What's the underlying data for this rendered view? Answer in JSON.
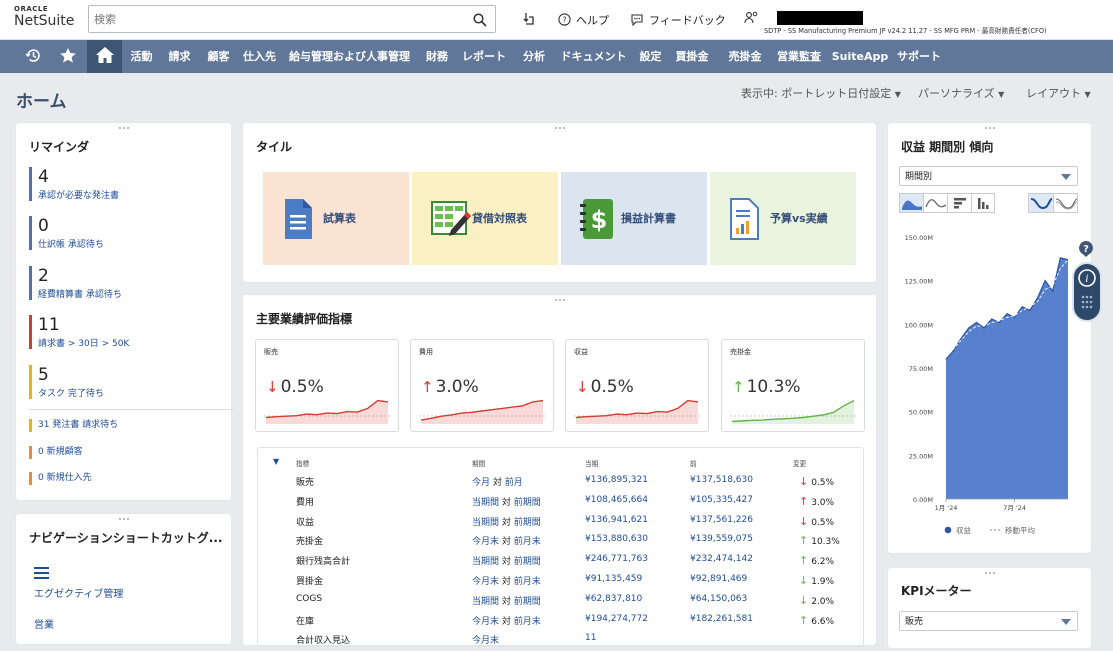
{
  "brand": {
    "oracle": "ORACLE",
    "netsuite": "NetSuite"
  },
  "topbar": {
    "search_placeholder": "検索",
    "help": "ヘルプ",
    "feedback": "フィードバック",
    "role": "SDTP - SS Manufacturing Premium JP v24.2 11.27 - SS MFG PRM - 最高財務責任者(CFO)"
  },
  "nav": {
    "items": [
      "活動",
      "請求",
      "顧客",
      "仕入先",
      "給与管理および人事管理",
      "財務",
      "レポート",
      "分析",
      "ドキュメント",
      "設定",
      "買掛金",
      "売掛金",
      "営業監査",
      "SuiteApp",
      "サポート"
    ]
  },
  "page": {
    "title": "ホーム",
    "view_label": "表示中: ポートレット日付設定",
    "personalize": "パーソナライズ",
    "layout": "レイアウト"
  },
  "reminders": {
    "title": "リマインダ",
    "items": [
      {
        "count": "4",
        "label": "承認が必要な発注書"
      },
      {
        "count": "0",
        "label": "仕訳帳 承認待ち"
      },
      {
        "count": "2",
        "label": "経費精算書 承認待ち"
      },
      {
        "count": "11",
        "label": "請求書 > 30日 > 50K"
      },
      {
        "count": "5",
        "label": "タスク 完了待ち"
      }
    ],
    "small": [
      "31 発注書 請求待ち",
      "0 新規顧客",
      "0 新規仕入先"
    ]
  },
  "shortcuts": {
    "title": "ナビゲーションショートカットグ...",
    "items": [
      "エグゼクティブ管理",
      "営業"
    ]
  },
  "tiles": {
    "title": "タイル",
    "items": [
      {
        "label": "試算表",
        "bg": "#fbe3d4"
      },
      {
        "label": "貸借対照表",
        "bg": "#fbf0c2"
      },
      {
        "label": "損益計算書",
        "bg": "#dce5ef"
      },
      {
        "label": "予算vs実績",
        "bg": "#e9f3dd"
      }
    ]
  },
  "kpi": {
    "title": "主要業績評価指標",
    "cards": [
      {
        "name": "販売",
        "value": "0.5%",
        "dir": "down",
        "color": "#d93a2f",
        "trend": [
          0.25,
          0.28,
          0.3,
          0.32,
          0.38,
          0.36,
          0.42,
          0.4,
          0.48,
          0.46,
          0.6,
          0.9,
          0.85
        ]
      },
      {
        "name": "費用",
        "value": "3.0%",
        "dir": "up",
        "color": "#d93a2f",
        "trend": [
          0.15,
          0.22,
          0.3,
          0.35,
          0.42,
          0.45,
          0.5,
          0.55,
          0.6,
          0.65,
          0.7,
          0.85,
          0.9
        ]
      },
      {
        "name": "収益",
        "value": "0.5%",
        "dir": "down",
        "color": "#d93a2f",
        "trend": [
          0.25,
          0.28,
          0.3,
          0.32,
          0.38,
          0.36,
          0.42,
          0.4,
          0.48,
          0.46,
          0.6,
          0.9,
          0.85
        ]
      },
      {
        "name": "売掛金",
        "value": "10.3%",
        "dir": "up",
        "color": "#5fb546",
        "trend": [
          0.1,
          0.12,
          0.14,
          0.15,
          0.18,
          0.2,
          0.22,
          0.25,
          0.3,
          0.35,
          0.45,
          0.7,
          0.9
        ]
      }
    ],
    "headers": {
      "metric": "指標",
      "period": "期間",
      "current": "当期",
      "previous": "前",
      "change": "変更"
    },
    "rows": [
      {
        "metric": "販売",
        "p1": "今月",
        "p2": "前月",
        "current": "¥136,895,321",
        "previous": "¥137,518,630",
        "change": "0.5%",
        "dir": "down",
        "color": "#d93a2f"
      },
      {
        "metric": "費用",
        "p1": "当期間",
        "p2": "前期間",
        "current": "¥108,465,664",
        "previous": "¥105,335,427",
        "change": "3.0%",
        "dir": "up",
        "color": "#d93a2f"
      },
      {
        "metric": "収益",
        "p1": "当期間",
        "p2": "前期間",
        "current": "¥136,941,621",
        "previous": "¥137,561,226",
        "change": "0.5%",
        "dir": "down",
        "color": "#d93a2f"
      },
      {
        "metric": "売掛金",
        "p1": "今月末",
        "p2": "前月末",
        "current": "¥153,880,630",
        "previous": "¥139,559,075",
        "change": "10.3%",
        "dir": "up",
        "color": "#5fb546"
      },
      {
        "metric": "銀行残高合計",
        "p1": "当期間",
        "p2": "前期間",
        "current": "¥246,771,763",
        "previous": "¥232,474,142",
        "change": "6.2%",
        "dir": "up",
        "color": "#5fb546"
      },
      {
        "metric": "買掛金",
        "p1": "今月末",
        "p2": "前月末",
        "current": "¥91,135,459",
        "previous": "¥92,891,469",
        "change": "1.9%",
        "dir": "down",
        "color": "#5fb546"
      },
      {
        "metric": "COGS",
        "p1": "当期間",
        "p2": "前期間",
        "current": "¥62,837,810",
        "previous": "¥64,150,063",
        "change": "2.0%",
        "dir": "down",
        "color": "#5fb546"
      },
      {
        "metric": "在庫",
        "p1": "今月末",
        "p2": "前月末",
        "current": "¥194,274,772",
        "previous": "¥182,261,581",
        "change": "6.6%",
        "dir": "up",
        "color": "#5fb546"
      },
      {
        "metric": "合計収入見込",
        "p1": "今月末",
        "p2": "",
        "current": "11",
        "previous": "",
        "change": "",
        "dir": "",
        "color": "#222"
      }
    ]
  },
  "trend": {
    "title": "収益 期間別 傾向",
    "period_select": "期間別",
    "legend": {
      "revenue": "収益",
      "moving_avg": "移動平均"
    }
  },
  "kpi_meter": {
    "title": "KPIメーター",
    "select": "販売"
  },
  "colors": {
    "nav": "#607799",
    "nav_active": "#3e5576",
    "link": "#1f4e96",
    "down": "#d93a2f",
    "up": "#5fb546",
    "area": "#4a76c9"
  },
  "chart_data": {
    "type": "area",
    "title": "収益 期間別 傾向",
    "yticks": [
      "150.00M",
      "125.00M",
      "100.00M",
      "75.00M",
      "50.00M",
      "25.00M",
      "0.00M"
    ],
    "ylim": [
      0,
      150
    ],
    "xticks": [
      "1月 '24",
      "7月 '24"
    ],
    "series": [
      {
        "name": "収益",
        "values": [
          80,
          85,
          92,
          98,
          101,
          98,
          103,
          101,
          106,
          104,
          110,
          108,
          115,
          125,
          119,
          138,
          137
        ]
      },
      {
        "name": "移動平均",
        "values": [
          81,
          86,
          91,
          96,
          99,
          99,
          101,
          102,
          104,
          105,
          108,
          110,
          113,
          120,
          122,
          132,
          137
        ]
      }
    ],
    "legend": "bottom"
  }
}
